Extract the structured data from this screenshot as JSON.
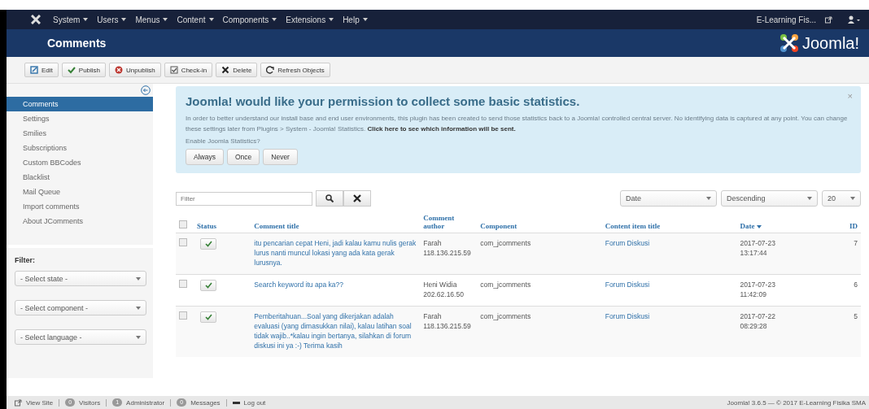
{
  "top_menu": [
    {
      "label": "System"
    },
    {
      "label": "Users"
    },
    {
      "label": "Menus"
    },
    {
      "label": "Content"
    },
    {
      "label": "Components"
    },
    {
      "label": "Extensions"
    },
    {
      "label": "Help"
    }
  ],
  "site_link": "E-Learning Fis...",
  "page_title": "Comments",
  "brand": "Joomla!",
  "toolbar": [
    {
      "kind": "edit",
      "label": "Edit"
    },
    {
      "kind": "publish",
      "label": "Publish"
    },
    {
      "kind": "unpublish",
      "label": "Unpublish"
    },
    {
      "kind": "checkin",
      "label": "Check-in"
    },
    {
      "kind": "delete",
      "label": "Delete"
    },
    {
      "kind": "refresh",
      "label": "Refresh Objects"
    }
  ],
  "sidebar": {
    "items": [
      {
        "label": "Comments",
        "selected": true
      },
      {
        "label": "Settings",
        "selected": false
      },
      {
        "label": "Smilies",
        "selected": false
      },
      {
        "label": "Subscriptions",
        "selected": false
      },
      {
        "label": "Custom BBCodes",
        "selected": false
      },
      {
        "label": "Blacklist",
        "selected": false
      },
      {
        "label": "Mail Queue",
        "selected": false
      },
      {
        "label": "Import comments",
        "selected": false
      },
      {
        "label": "About JComments",
        "selected": false
      }
    ],
    "filter_label": "Filter:",
    "filters": [
      "- Select state -",
      "- Select component -",
      "- Select language -"
    ]
  },
  "stats_message": {
    "title": "Joomla! would like your permission to collect some basic statistics.",
    "body": "In order to better understand our install base and end user environments, this plugin has been created to send those statistics back to a Joomla! controlled central server. No identifying data is captured at any point. You can change these settings later from Plugins > System - Joomla! Statistics. **Click here to see which information will be sent.**",
    "question": "Enable Joomla Statistics?",
    "buttons": [
      "Always",
      "Once",
      "Never"
    ],
    "close": "×"
  },
  "search": {
    "placeholder": "Filter"
  },
  "sort": {
    "field": "Date",
    "order": "Descending",
    "limit": "20"
  },
  "table": {
    "select_all_checked": false,
    "columns": [
      "Status",
      "Comment title",
      "Comment author",
      "Component",
      "Content item title",
      "Date",
      "ID"
    ],
    "rows": [
      {
        "checked": false,
        "published": true,
        "title": "itu pencarian cepat Heni, jadi kalau kamu nulis gerak lurus nanti muncul lokasi yang ada kata gerak lurusnya.",
        "author": "Farah",
        "ip": "118.136.215.59",
        "component": "com_jcomments",
        "item": "Forum Diskusi",
        "date": "2017-07-23",
        "time": "13:17:44",
        "id": "7"
      },
      {
        "checked": false,
        "published": true,
        "title": "Search keyword itu apa ka??",
        "author": "Heni Widia",
        "ip": "202.62.16.50",
        "component": "com_jcomments",
        "item": "Forum Diskusi",
        "date": "2017-07-23",
        "time": "11:42:09",
        "id": "6"
      },
      {
        "checked": false,
        "published": true,
        "title": "Pemberitahuan...Soal yang dikerjakan adalah evaluasi (yang dimasukkan nilai), kalau latihan soal tidak wajib..*kalau ingin bertanya, silahkan di forum diskusi ini ya :-) Terima kasih",
        "author": "Farah",
        "ip": "118.136.215.59",
        "component": "com_jcomments",
        "item": "Forum Diskusi",
        "date": "2017-07-22",
        "time": "08:29:28",
        "id": "5"
      }
    ]
  },
  "status_bar": {
    "view_site": "View Site",
    "items": [
      {
        "count": "0",
        "label": "Visitors"
      },
      {
        "count": "1",
        "label": "Administrator"
      },
      {
        "count": "0",
        "label": "Messages"
      }
    ],
    "logout": "Log out",
    "version": "Joomla! 3.6.5 — © 2017 E-Learning Fisika SMA"
  }
}
